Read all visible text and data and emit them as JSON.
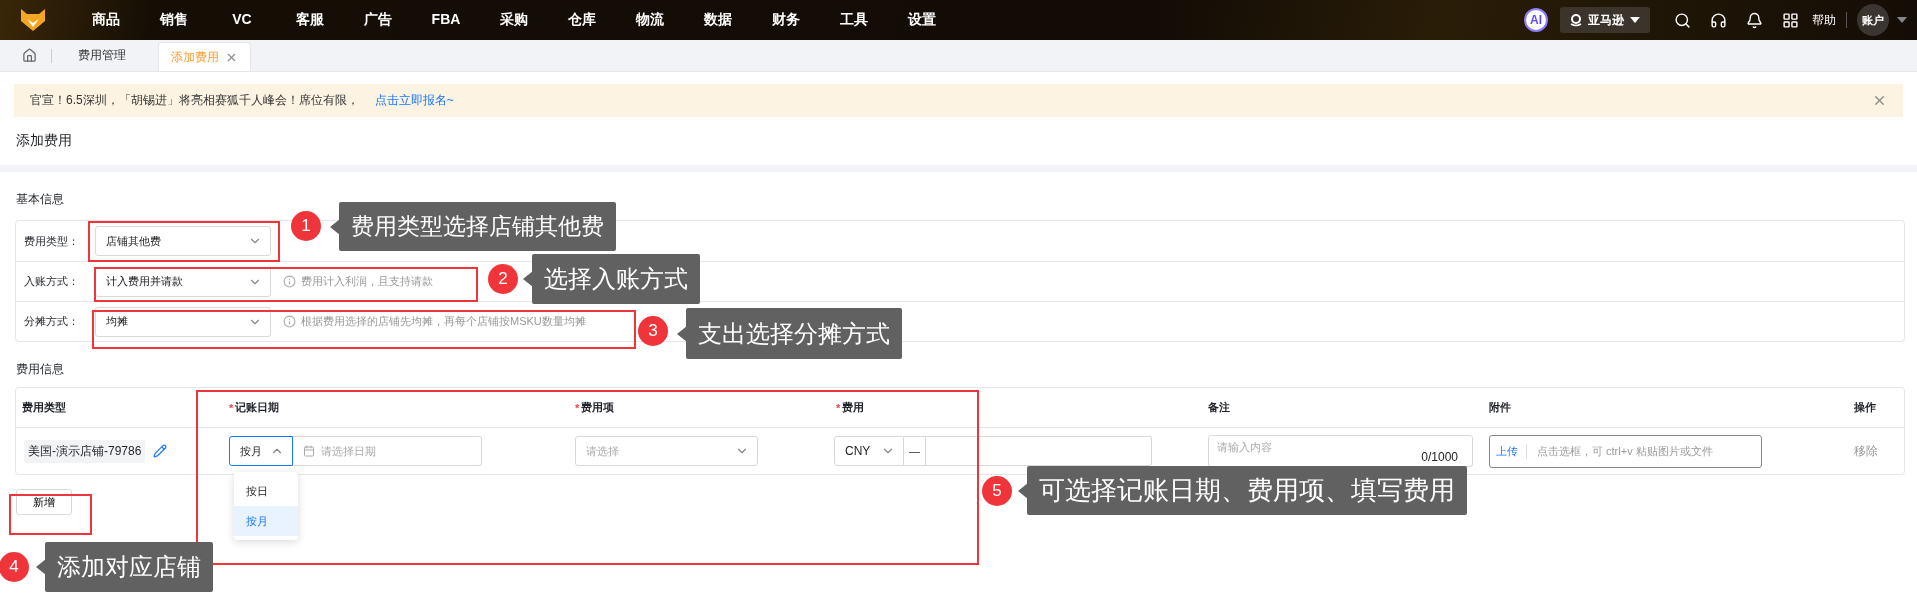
{
  "top_nav": {
    "items": [
      "商品",
      "销售",
      "VC",
      "客服",
      "广告",
      "FBA",
      "采购",
      "仓库",
      "物流",
      "数据",
      "财务",
      "工具",
      "设置"
    ],
    "ai_badge": "AI",
    "platform_select": "亚马逊",
    "help": "帮助",
    "account": "账户"
  },
  "tabs": [
    {
      "label": "费用管理",
      "selected": false,
      "closable": false
    },
    {
      "label": "添加费用",
      "selected": true,
      "closable": true
    }
  ],
  "notice": {
    "text": "官宣！6.5深圳，「胡锡进」将亮相赛狐千人峰会！席位有限，",
    "link": "点击立即报名~"
  },
  "page_title": "添加费用",
  "basic_info": {
    "title": "基本信息",
    "rows": [
      {
        "label": "费用类型：",
        "value": "店铺其他费"
      },
      {
        "label": "入账方式：",
        "value": "计入费用并请款",
        "hint": "费用计入利润，且支持请款"
      },
      {
        "label": "分摊方式：",
        "value": "均摊",
        "hint": "根据费用选择的店铺先均摊，再每个店铺按MSKU数量均摊"
      }
    ]
  },
  "expense_info": {
    "title": "费用信息",
    "columns": [
      {
        "label": "费用类型"
      },
      {
        "label": "记账日期",
        "required_mark": "*"
      },
      {
        "label": "费用项",
        "required_mark": "*"
      },
      {
        "label": "费用",
        "required_mark": "*"
      },
      {
        "label": "备注"
      },
      {
        "label": "附件"
      },
      {
        "label": "操作"
      }
    ],
    "rows": [
      {
        "store": "美国-演示店铺-79786",
        "date_mode": "按月",
        "date_placeholder": "请选择日期",
        "item_placeholder": "请选择",
        "currency": "CNY",
        "amount_prefix": "—",
        "remark_placeholder": "请输入内容",
        "remark_count": "0/1000",
        "upload": "上传",
        "upload_hint": "点击选框，可 ctrl+v 粘贴图片或文件",
        "action": "移除"
      }
    ],
    "date_mode_menu": [
      {
        "label": "按日",
        "selected": false
      },
      {
        "label": "按月",
        "selected": true
      }
    ],
    "add_button": "新增"
  },
  "annotations": [
    {
      "number": "1",
      "text": "费用类型选择店铺其他费"
    },
    {
      "number": "2",
      "text": "选择入账方式"
    },
    {
      "number": "3",
      "text": "支出选择分摊方式"
    },
    {
      "number": "4",
      "text": "添加对应店铺"
    },
    {
      "number": "5",
      "text": "可选择记账日期、费用项、填写费用"
    }
  ]
}
